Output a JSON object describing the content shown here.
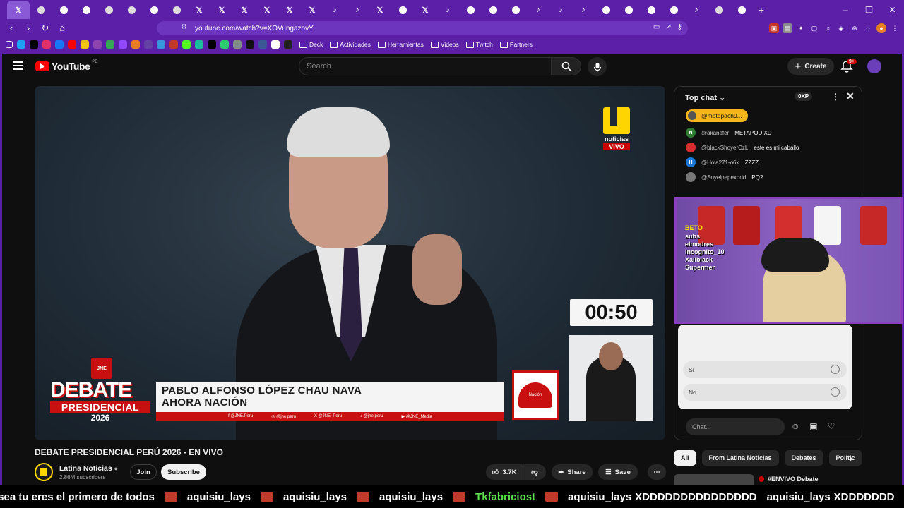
{
  "browser": {
    "tabs": [
      "x",
      "g",
      "w",
      "w",
      "g",
      "g",
      "w",
      "g",
      "x",
      "x",
      "x",
      "x",
      "x",
      "x",
      "t",
      "t",
      "x",
      "w",
      "x",
      "t",
      "w",
      "w",
      "w",
      "t",
      "t",
      "t",
      "w",
      "w",
      "w",
      "w",
      "t",
      "g",
      "w"
    ],
    "new_tab": "+",
    "window_controls": {
      "minimize": "–",
      "maximize": "❐",
      "close": "✕"
    },
    "url": "youtube.com/watch?v=XOVungazovY",
    "bookmarks": [
      {
        "label": "Deck"
      },
      {
        "label": "Actividades"
      },
      {
        "label": "Herramientas"
      },
      {
        "label": "Videos"
      },
      {
        "label": "Twitch"
      },
      {
        "label": "Partners"
      }
    ]
  },
  "youtube": {
    "logo_text": "YouTube",
    "country_code": "PE",
    "search_placeholder": "Search",
    "create_label": "Create",
    "notif_count": "9+"
  },
  "video": {
    "channel_brand": "noticias",
    "live_badge": "VIVO",
    "timer": "00:50",
    "jne_label": "JNE",
    "debate_line1": "DEBATE",
    "debate_line2": "PRESIDENCIAL",
    "debate_year": "2026",
    "lower_third_line1": "PABLO ALFONSO LÓPEZ CHAU NAVA",
    "lower_third_line2": "AHORA NACIÓN",
    "social_handles": [
      "f @JNE.Peru",
      "◎ @jne.peru",
      "X @JNE_Peru",
      "♪ @jne.peru",
      "▶ @JNE_Media"
    ],
    "party_label": "Nación"
  },
  "meta": {
    "title": "DEBATE PRESIDENCIAL PERÚ 2026 - EN VIVO",
    "channel": "Latina Noticias",
    "subscribers": "2.86M subscribers",
    "join": "Join",
    "subscribe": "Subscribe",
    "likes": "3.7K",
    "share": "Share",
    "save": "Save"
  },
  "chat": {
    "header": "Top chat",
    "xp": "0XP",
    "pinned_user": "@motopach9...",
    "messages": [
      {
        "initial": "N",
        "color": "#2e7d32",
        "user": "@akanefer",
        "text": "METAPOD XD"
      },
      {
        "initial": "",
        "color": "#d32f2f",
        "user": "@blackShoyerCzL",
        "text": "este es mi caballo"
      },
      {
        "initial": "H",
        "color": "#1976d2",
        "user": "@Hola271-o6k",
        "text": "ZZZZ"
      },
      {
        "initial": "",
        "color": "#777777",
        "user": "@Soyelpepexddd",
        "text": "PQ?"
      }
    ],
    "poll_options": [
      "Sí",
      "No"
    ],
    "input_placeholder": "Chat..."
  },
  "stream_overlay": {
    "brand": "BETO",
    "subs_label": "subs",
    "names": [
      "elmodres",
      "Incognito_10",
      "Xallblack",
      "Supermer"
    ]
  },
  "chips": [
    "All",
    "From Latina Noticias",
    "Debates",
    "Politic"
  ],
  "related": {
    "title": "#ENVIVO Debate"
  },
  "ticker": [
    {
      "user": "",
      "text": "osea tu eres el primero de todos",
      "emote": true,
      "green": false
    },
    {
      "user": "aquisiu_lays",
      "text": "",
      "emote": true,
      "green": false
    },
    {
      "user": "aquisiu_lays",
      "text": "",
      "emote": true,
      "green": false
    },
    {
      "user": "aquisiu_lays",
      "text": "",
      "emote": true,
      "green": false
    },
    {
      "user": "Tkfabriciost",
      "text": "",
      "emote": true,
      "green": true
    },
    {
      "user": "aquisiu_lays",
      "text": "XDDDDDDDDDDDDDDD",
      "emote": false,
      "green": false
    },
    {
      "user": "aquisiu_lays",
      "text": "XDDDDDDD",
      "emote": false,
      "green": false
    }
  ]
}
